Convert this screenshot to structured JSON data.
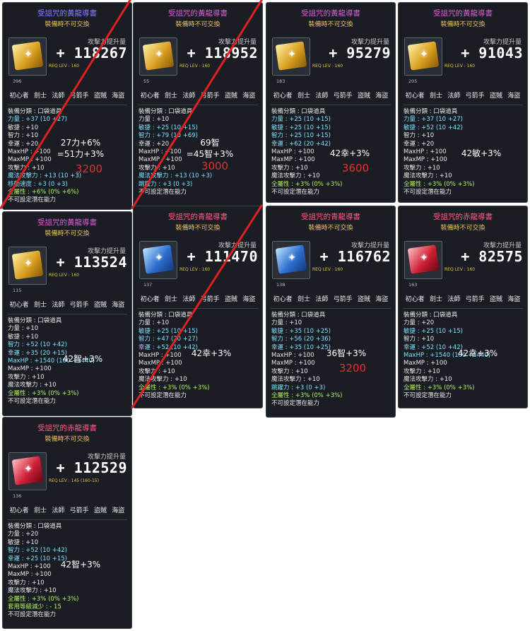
{
  "cards": [
    {
      "name": "受詛咒的黃龍導書",
      "trade": "裝備時不可交換",
      "attack_label": "攻擊力提升量",
      "attack": "+ 118267",
      "req_text": "REQ LEV : 160",
      "item_level": "396",
      "jobs": [
        "初心者",
        "劍士",
        "法師",
        "弓箭手",
        "盜賊",
        "海盜"
      ],
      "stats": [
        {
          "t": "裝備分類 : 口袋道具",
          "c": ""
        },
        {
          "t": "力量 : +37 (10 +27)",
          "c": "h"
        },
        {
          "t": "敏捷 : +10",
          "c": ""
        },
        {
          "t": "智力 : +10",
          "c": ""
        },
        {
          "t": "幸運 : +20",
          "c": ""
        },
        {
          "t": "MaxHP : +100",
          "c": ""
        },
        {
          "t": "MaxMP : +100",
          "c": ""
        },
        {
          "t": "攻擊力 : +10",
          "c": ""
        },
        {
          "t": "魔法攻擊力 : +13 (10 +3)",
          "c": "h"
        },
        {
          "t": "移動速度 : +3 (0 +3)",
          "c": "h"
        },
        {
          "t": "全屬性 : +6% (0% +6%)",
          "c": "g"
        },
        {
          "t": "不可設定潛在能力",
          "c": ""
        }
      ],
      "note": "27力+6%\n=51力+3%",
      "price": "3200"
    },
    {
      "name": "受詛咒的黃龍導書",
      "trade": "裝備時不可交換",
      "attack_label": "攻擊力提升量",
      "attack": "+ 118952",
      "req_text": "REQ LEV : 160",
      "item_level": "55",
      "jobs": [
        "初心者",
        "劍士",
        "法師",
        "弓箭手",
        "盜賊",
        "海盜"
      ],
      "stats": [
        {
          "t": "裝備分類 : 口袋道具",
          "c": ""
        },
        {
          "t": "力量 : +10",
          "c": ""
        },
        {
          "t": "敏捷 : +25 (10 +15)",
          "c": "h"
        },
        {
          "t": "智力 : +79 (10 +69)",
          "c": "h"
        },
        {
          "t": "幸運 : +20",
          "c": ""
        },
        {
          "t": "MaxHP : +100",
          "c": ""
        },
        {
          "t": "MaxMP : +100",
          "c": ""
        },
        {
          "t": "攻擊力 : +10",
          "c": ""
        },
        {
          "t": "魔法攻擊力 : +13 (10 +3)",
          "c": "h"
        },
        {
          "t": "跳躍力 : +3 (0 +3)",
          "c": "h"
        },
        {
          "t": "不可設定潛在能力",
          "c": ""
        }
      ],
      "note": "69智\n=45智+3%",
      "price": "3000"
    },
    {
      "name": "受詛咒的黃龍導書",
      "trade": "裝備時不可交換",
      "attack_label": "攻擊力提升量",
      "attack": "+ 95279",
      "req_text": "REQ LEV : 160",
      "item_level": "183",
      "jobs": [
        "初心者",
        "劍士",
        "法師",
        "弓箭手",
        "盜賊",
        "海盜"
      ],
      "stats": [
        {
          "t": "裝備分類 : 口袋道具",
          "c": ""
        },
        {
          "t": "力量 : +25 (10 +15)",
          "c": "h"
        },
        {
          "t": "敏捷 : +25 (10 +15)",
          "c": "h"
        },
        {
          "t": "智力 : +25 (10 +15)",
          "c": "h"
        },
        {
          "t": "幸運 : +62 (20 +42)",
          "c": "h"
        },
        {
          "t": "MaxHP : +100",
          "c": ""
        },
        {
          "t": "MaxMP : +100",
          "c": ""
        },
        {
          "t": "攻擊力 : +10",
          "c": ""
        },
        {
          "t": "魔法攻擊力 : +10",
          "c": ""
        },
        {
          "t": "全屬性 : +3% (0% +3%)",
          "c": "g"
        },
        {
          "t": "不可設定潛在能力",
          "c": ""
        }
      ],
      "note": "42幸+3%",
      "price": "3600"
    },
    {
      "name": "受詛咒的黃龍導書",
      "trade": "裝備時不可交換",
      "attack_label": "攻擊力提升量",
      "attack": "+ 91043",
      "req_text": "REQ LEV : 160",
      "item_level": "205",
      "jobs": [
        "初心者",
        "劍士",
        "法師",
        "弓箭手",
        "盜賊",
        "海盜"
      ],
      "stats": [
        {
          "t": "裝備分類 : 口袋道具",
          "c": ""
        },
        {
          "t": "力量 : +37 (10 +27)",
          "c": "h"
        },
        {
          "t": "敏捷 : +52 (10 +42)",
          "c": "h"
        },
        {
          "t": "智力 : +10",
          "c": ""
        },
        {
          "t": "幸運 : +20",
          "c": ""
        },
        {
          "t": "MaxHP : +100",
          "c": ""
        },
        {
          "t": "MaxMP : +100",
          "c": ""
        },
        {
          "t": "攻擊力 : +10",
          "c": ""
        },
        {
          "t": "魔法攻擊力 : +10",
          "c": ""
        },
        {
          "t": "全屬性 : +3% (0% +3%)",
          "c": "g"
        },
        {
          "t": "不可設定潛在能力",
          "c": ""
        }
      ],
      "note": "42敏+3%",
      "price": ""
    },
    {
      "name": "受詛咒的黃龍導書",
      "trade": "裝備時不可交換",
      "attack_label": "攻擊力提升量",
      "attack": "+ 113524",
      "req_text": "REQ LEV : 160",
      "item_level": "115",
      "jobs": [
        "初心者",
        "劍士",
        "法師",
        "弓箭手",
        "盜賊",
        "海盜"
      ],
      "stats": [
        {
          "t": "裝備分類 : 口袋道具",
          "c": ""
        },
        {
          "t": "力量 : +10",
          "c": ""
        },
        {
          "t": "敏捷 : +10",
          "c": ""
        },
        {
          "t": "智力 : +52 (10 +42)",
          "c": "h"
        },
        {
          "t": "幸運 : +35 (20 +15)",
          "c": "h"
        },
        {
          "t": "MaxHP : +1540 (100 +1440)",
          "c": "h"
        },
        {
          "t": "MaxMP : +100",
          "c": ""
        },
        {
          "t": "攻擊力 : +10",
          "c": ""
        },
        {
          "t": "魔法攻擊力 : +10",
          "c": ""
        },
        {
          "t": "全屬性 : +3% (0% +3%)",
          "c": "g"
        },
        {
          "t": "不可設定潛在能力",
          "c": ""
        }
      ],
      "note": "42智+3%",
      "price": ""
    },
    {
      "name": "受詛咒的青龍導書",
      "trade": "裝備時不可交換",
      "attack_label": "攻擊力提升量",
      "attack": "+ 111470",
      "req_text": "REQ LEV : 160",
      "item_level": "137",
      "jobs": [
        "初心者",
        "劍士",
        "法師",
        "弓箭手",
        "盜賊",
        "海盜"
      ],
      "stats": [
        {
          "t": "裝備分類 : 口袋道具",
          "c": ""
        },
        {
          "t": "力量 : +10",
          "c": ""
        },
        {
          "t": "敏捷 : +25 (10 +15)",
          "c": "h"
        },
        {
          "t": "智力 : +47 (20 +27)",
          "c": "h"
        },
        {
          "t": "幸運 : +52 (10 +42)",
          "c": "h"
        },
        {
          "t": "MaxHP : +100",
          "c": ""
        },
        {
          "t": "MaxMP : +100",
          "c": ""
        },
        {
          "t": "攻擊力 : +10",
          "c": ""
        },
        {
          "t": "魔法攻擊力 : +10",
          "c": ""
        },
        {
          "t": "全屬性 : +3% (0% +3%)",
          "c": "g"
        },
        {
          "t": "不可設定潛在能力",
          "c": ""
        }
      ],
      "note": "42幸+3%",
      "price": ""
    },
    {
      "name": "受詛咒的青龍導書",
      "trade": "裝備時不可交換",
      "attack_label": "攻擊力提升量",
      "attack": "+ 116762",
      "req_text": "REQ LEV : 160",
      "item_level": "138",
      "jobs": [
        "初心者",
        "劍士",
        "法師",
        "弓箭手",
        "盜賊",
        "海盜"
      ],
      "stats": [
        {
          "t": "裝備分類 : 口袋道具",
          "c": ""
        },
        {
          "t": "力量 : +10",
          "c": ""
        },
        {
          "t": "敏捷 : +35 (10 +25)",
          "c": "h"
        },
        {
          "t": "智力 : +56 (20 +36)",
          "c": "h"
        },
        {
          "t": "幸運 : +35 (10 +25)",
          "c": "h"
        },
        {
          "t": "MaxHP : +100",
          "c": ""
        },
        {
          "t": "MaxMP : +100",
          "c": ""
        },
        {
          "t": "攻擊力 : +10",
          "c": ""
        },
        {
          "t": "魔法攻擊力 : +10",
          "c": ""
        },
        {
          "t": "跳躍力 : +3 (0 +3)",
          "c": "h"
        },
        {
          "t": "全屬性 : +3% (0% +3%)",
          "c": "g"
        },
        {
          "t": "不可設定潛在能力",
          "c": ""
        }
      ],
      "note": "36智+3%",
      "price": "3200"
    },
    {
      "name": "受詛咒的赤龍導書",
      "trade": "裝備時不可交換",
      "attack_label": "攻擊力提升量",
      "attack": "+ 82575",
      "req_text": "REQ LEV : 160",
      "item_level": "163",
      "jobs": [
        "初心者",
        "劍士",
        "法師",
        "弓箭手",
        "盜賊",
        "海盜"
      ],
      "stats": [
        {
          "t": "裝備分類 : 口袋道具",
          "c": ""
        },
        {
          "t": "力量 : +20",
          "c": ""
        },
        {
          "t": "敏捷 : +25 (10 +15)",
          "c": "h"
        },
        {
          "t": "智力 : +10",
          "c": ""
        },
        {
          "t": "幸運 : +52 (10 +42)",
          "c": "h"
        },
        {
          "t": "MaxHP : +1540 (100 +1440)",
          "c": "h"
        },
        {
          "t": "MaxMP : +100",
          "c": ""
        },
        {
          "t": "攻擊力 : +10",
          "c": ""
        },
        {
          "t": "魔法攻擊力 : +10",
          "c": ""
        },
        {
          "t": "全屬性 : +3% (0% +3%)",
          "c": "g"
        },
        {
          "t": "不可設定潛在能力",
          "c": ""
        }
      ],
      "note": "42幸+3%",
      "price": ""
    },
    {
      "name": "受詛咒的赤龍導書",
      "trade": "裝備時不可交換",
      "attack_label": "攻擊力提升量",
      "attack": "+ 112529",
      "req_text": "REQ LEV : 145 (160-15)",
      "item_level": "136",
      "jobs": [
        "初心者",
        "劍士",
        "法師",
        "弓箭手",
        "盜賊",
        "海盜"
      ],
      "stats": [
        {
          "t": "裝備分類 : 口袋道具",
          "c": ""
        },
        {
          "t": "力量 : +20",
          "c": ""
        },
        {
          "t": "敏捷 : +10",
          "c": ""
        },
        {
          "t": "智力 : +52 (10 +42)",
          "c": "h"
        },
        {
          "t": "幸運 : +25 (10 +15)",
          "c": "h"
        },
        {
          "t": "MaxHP : +100",
          "c": ""
        },
        {
          "t": "MaxMP : +100",
          "c": ""
        },
        {
          "t": "攻擊力 : +10",
          "c": ""
        },
        {
          "t": "魔法攻擊力 : +10",
          "c": ""
        },
        {
          "t": "全屬性 : +3% (0% +3%)",
          "c": "g"
        },
        {
          "t": "套用等級減少 : - 15",
          "c": "g"
        },
        {
          "t": "不可設定潛在能力",
          "c": ""
        }
      ],
      "note": "42智+3%",
      "price": ""
    }
  ],
  "colors": {
    "slash": "#e02020",
    "price": "#e03030",
    "highlight": "#7fe0ff",
    "green": "#b0f060"
  }
}
